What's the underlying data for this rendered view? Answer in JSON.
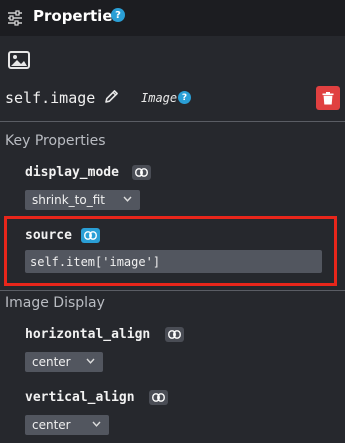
{
  "header": {
    "title": "Properties",
    "help": "?"
  },
  "component": {
    "name": "self.image",
    "type": "Image",
    "type_help": "?"
  },
  "sections": {
    "key_properties": "Key Properties",
    "image_display": "Image Display"
  },
  "props": {
    "display_mode": {
      "label": "display_mode",
      "value": "shrink_to_fit"
    },
    "source": {
      "label": "source",
      "value": "self.item['image']"
    },
    "horizontal_align": {
      "label": "horizontal_align",
      "value": "center"
    },
    "vertical_align": {
      "label": "vertical_align",
      "value": "center"
    }
  },
  "colors": {
    "accent": "#2a9fd6",
    "delete": "#e04040",
    "highlight": "#e8261b"
  },
  "icons": [
    "sliders-icon",
    "help-icon",
    "image-icon",
    "pencil-icon",
    "trash-icon",
    "link-icon",
    "chevron-down-icon"
  ]
}
